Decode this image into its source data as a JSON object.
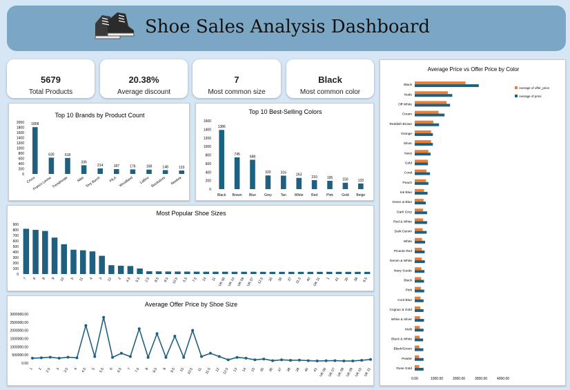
{
  "header": {
    "title": "Shoe Sales Analysis Dashboard",
    "logo_icon": "sneakers-icon"
  },
  "kpis": [
    {
      "value": "5679",
      "label": "Total Products"
    },
    {
      "value": "20.38%",
      "label": "Average discount"
    },
    {
      "value": "7",
      "label": "Most common size"
    },
    {
      "value": "Black",
      "label": "Most common color"
    }
  ],
  "colors": {
    "bar": "#1f5f80",
    "offer": "#ed7d31",
    "price": "#1f5f80"
  },
  "chart_data": [
    {
      "id": "brands",
      "type": "bar",
      "title": "Top 10 Brands by Product Count",
      "categories": [
        "Crocs",
        "Franco Leone",
        "Trendmode",
        "Nike",
        "Tory Burch",
        "FILA",
        "Woodland",
        "LaBrio",
        "Bucikstore",
        "Reebok"
      ],
      "values": [
        1808,
        630,
        618,
        336,
        214,
        187,
        176,
        168,
        148,
        133
      ],
      "yticks": [
        "0",
        "200",
        "400",
        "600",
        "800",
        "1000",
        "1200",
        "1400",
        "1600",
        "1800",
        "2000"
      ],
      "ylim": [
        0,
        2000
      ]
    },
    {
      "id": "colors",
      "type": "bar",
      "title": "Top 10 Best-Selling Colors",
      "categories": [
        "Black",
        "Brown",
        "Blue",
        "Grey",
        "Tan",
        "White",
        "Red",
        "Pink",
        "Gold",
        "Beige"
      ],
      "values": [
        1386,
        745,
        688,
        320,
        316,
        263,
        210,
        195,
        150,
        133
      ],
      "yticks": [
        "0",
        "200",
        "400",
        "600",
        "800",
        "1000",
        "1200",
        "1400",
        "1600"
      ],
      "ylim": [
        0,
        1600
      ]
    },
    {
      "id": "sizes",
      "type": "bar",
      "title": "Most Popular Shoe Sizes",
      "categories": [
        "7",
        "6",
        "8",
        "9",
        "10",
        "5",
        "11",
        "4",
        "3",
        "12",
        "2",
        "4.5",
        "5.5",
        "2.5",
        "8.5",
        "9.5",
        "10.5",
        "5.5",
        "7.5",
        "14",
        "11",
        "UK 06",
        "UK 10",
        "UK 09",
        "UK 07",
        "12.5",
        "35",
        "36",
        "37",
        "11.5",
        "40",
        "UK 11",
        "1",
        "41",
        "35",
        "38",
        "6.5"
      ],
      "values": [
        820,
        800,
        780,
        660,
        540,
        440,
        430,
        410,
        330,
        160,
        150,
        145,
        100,
        50,
        48,
        46,
        45,
        44,
        43,
        42,
        42,
        42,
        41,
        41,
        41,
        40,
        40,
        40,
        40,
        40,
        40,
        40,
        40,
        40,
        40,
        40,
        40
      ],
      "yticks": [
        "0",
        "100",
        "200",
        "300",
        "400",
        "500",
        "600",
        "700",
        "800",
        "900"
      ],
      "ylim": [
        0,
        900
      ]
    },
    {
      "id": "offer",
      "type": "line",
      "title": "Average Offer Price by Shoe Size",
      "categories": [
        "1",
        "2",
        "2.5",
        "3",
        "3.5",
        "4",
        "4.5",
        "5",
        "5.5",
        "6",
        "6.5",
        "7",
        "7.5",
        "8",
        "8.5",
        "9",
        "9.5",
        "10",
        "10.5",
        "11",
        "11.5",
        "12",
        "12.5",
        "13",
        "14",
        "15",
        "35",
        "36",
        "37",
        "38",
        "39",
        "40",
        "41",
        "UK 06",
        "UK 07",
        "UK 08",
        "UK 09",
        "UK 10",
        "UK 11"
      ],
      "values": [
        3000,
        3200,
        3600,
        3000,
        3600,
        3200,
        23000,
        4000,
        28000,
        3500,
        6000,
        4000,
        21000,
        3500,
        18000,
        3500,
        16500,
        3500,
        20000,
        4000,
        6000,
        4000,
        2000,
        3500,
        3000,
        2000,
        2500,
        1500,
        2000,
        1700,
        1800,
        1500,
        1300,
        1400,
        1500,
        1300,
        1300,
        1700,
        2200
      ],
      "yticks": [
        "0.00",
        "500000.00",
        "1000000.00",
        "1500000.00",
        "2000000.00",
        "2500000.00",
        "3000000.00"
      ],
      "ylim": [
        0,
        30000
      ]
    },
    {
      "id": "pricecolor",
      "type": "bar",
      "title": "Average Price vs Offer Price by Color",
      "categories": [
        "Black",
        "Nude",
        "Off White",
        "Cream",
        "Reddish Brown",
        "Orange",
        "Silver",
        "Navy",
        "Gold",
        "Coral",
        "Peach",
        "Ink Blue",
        "Green & Blue",
        "Dark Grey",
        "Red & White",
        "Dark Denim",
        "White",
        "Picante Red",
        "Denim & White",
        "Navy Suede",
        "Black",
        "Pink",
        "Cool Blue",
        "Cognac & Gold",
        "White & Silver",
        "Multi",
        "Black & White",
        "Black/Green",
        "Pewter",
        "Rose Gold"
      ],
      "series": [
        {
          "name": "Average of offer_price",
          "values": [
            2300,
            1500,
            1440,
            1080,
            840,
            740,
            740,
            620,
            600,
            530,
            510,
            420,
            400,
            380,
            380,
            360,
            330,
            320,
            310,
            300,
            290,
            280,
            260,
            250,
            240,
            230,
            220,
            210,
            200,
            200
          ]
        },
        {
          "name": "Average of price",
          "values": [
            2900,
            1700,
            1600,
            1350,
            1100,
            820,
            820,
            720,
            600,
            690,
            620,
            580,
            500,
            560,
            560,
            540,
            470,
            450,
            460,
            440,
            420,
            430,
            400,
            400,
            420,
            400,
            380,
            390,
            400,
            400
          ]
        }
      ],
      "xticks": [
        "0.00",
        "1000.00",
        "2000.00",
        "3000.00",
        "4000.00"
      ],
      "xlim": [
        0,
        4000
      ]
    }
  ]
}
